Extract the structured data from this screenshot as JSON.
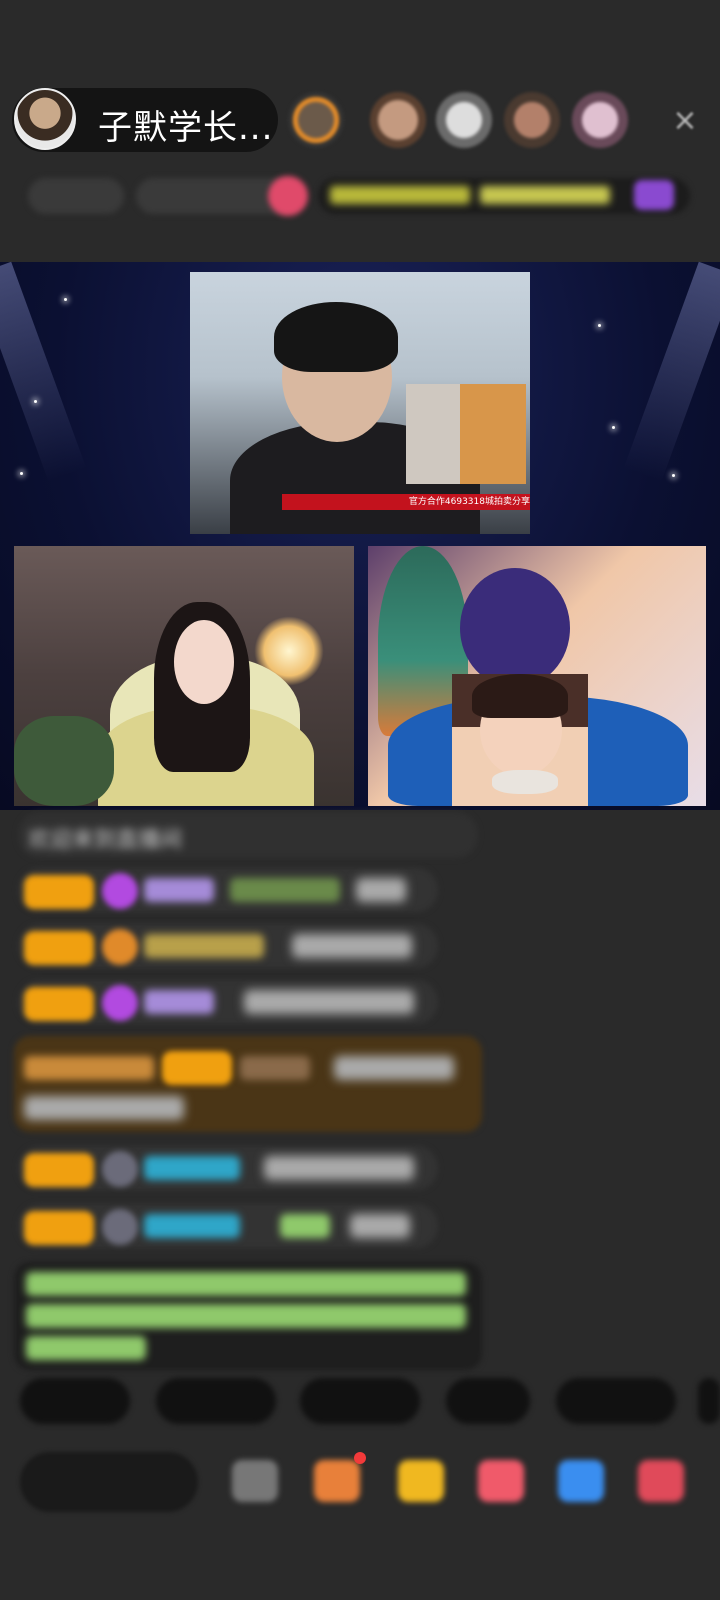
{
  "header": {
    "host_name": "子默学长...",
    "close_icon_label": "×"
  },
  "stage": {
    "banner_text": "官方合作4693318城拍卖分享"
  },
  "chat": {
    "system_notice": "欢迎来到直播间",
    "lines": [
      {
        "badge": "",
        "user": "",
        "text": ""
      },
      {
        "badge": "",
        "user": "",
        "text": ""
      },
      {
        "badge": "",
        "user": "",
        "text": ""
      }
    ]
  },
  "quick_replies": [
    "",
    "",
    "",
    "",
    ""
  ],
  "input_placeholder": "",
  "colors": {
    "badge_gold": "#f0a010",
    "username_purple": "#a58bd8",
    "username_cyan": "#2fa6c8",
    "highlight_green": "#8fc96b"
  }
}
